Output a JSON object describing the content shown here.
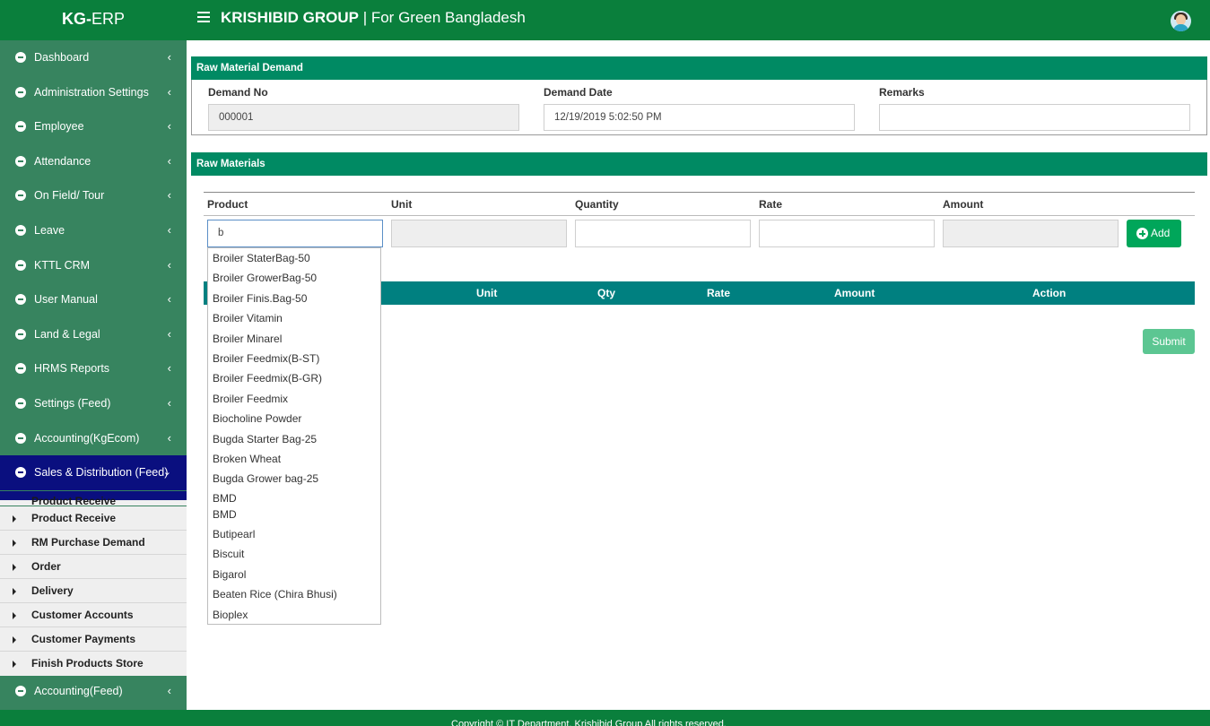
{
  "app": {
    "logo_bold": "KG-",
    "logo_rest": "ERP",
    "brand_bold": "KRISHIBID GROUP",
    "brand_rest": "| For Green Bangladesh"
  },
  "sidebar": {
    "items": [
      {
        "label": "Dashboard"
      },
      {
        "label": "Administration Settings"
      },
      {
        "label": "Employee"
      },
      {
        "label": "Attendance"
      },
      {
        "label": "On Field/ Tour"
      },
      {
        "label": "Leave"
      },
      {
        "label": "KTTL CRM"
      },
      {
        "label": "User Manual"
      },
      {
        "label": "Land & Legal"
      },
      {
        "label": "HRMS Reports"
      },
      {
        "label": "Settings (Feed)"
      },
      {
        "label": "Accounting(KgEcom)"
      },
      {
        "label": "Sales & Distribution (Feed)"
      }
    ],
    "hidden_item": "Product Receive",
    "submenu": [
      "Product Receive",
      "RM Purchase Demand",
      "Order",
      "Delivery",
      "Customer Accounts",
      "Customer Payments",
      "Finish Products Store"
    ],
    "last_item": "Accounting(Feed)"
  },
  "demand": {
    "title": "Raw Material Demand",
    "demand_no_label": "Demand No",
    "demand_no_value": "000001",
    "demand_date_label": "Demand Date",
    "demand_date_value": "12/19/2019 5:02:50 PM",
    "remarks_label": "Remarks",
    "remarks_value": ""
  },
  "materials": {
    "title": "Raw Materials",
    "product_label": "Product",
    "unit_label": "Unit",
    "quantity_label": "Quantity",
    "rate_label": "Rate",
    "amount_label": "Amount",
    "product_value": "b",
    "add_label": "Add"
  },
  "table": {
    "headers": [
      "Unit",
      "Qty",
      "Rate",
      "Amount",
      "Action"
    ]
  },
  "submit_label": "Submit",
  "dropdown": [
    "Broiler StaterBag-50",
    "Broiler GrowerBag-50",
    "Broiler Finis.Bag-50",
    "Broiler Vitamin",
    "Broiler Minarel",
    "Broiler Feedmix(B-ST)",
    "Broiler Feedmix(B-GR)",
    "Broiler Feedmix",
    "Biocholine Powder",
    "Bugda Starter Bag-25",
    "Broken Wheat",
    "Bugda Grower bag-25",
    "BMD",
    "BMD",
    "Butipearl",
    "Biscuit",
    "Bigarol",
    "Beaten Rice (Chira Bhusi)",
    "Bioplex"
  ],
  "footer": "Copyright © IT Department, Krishibid Group All rights reserved."
}
